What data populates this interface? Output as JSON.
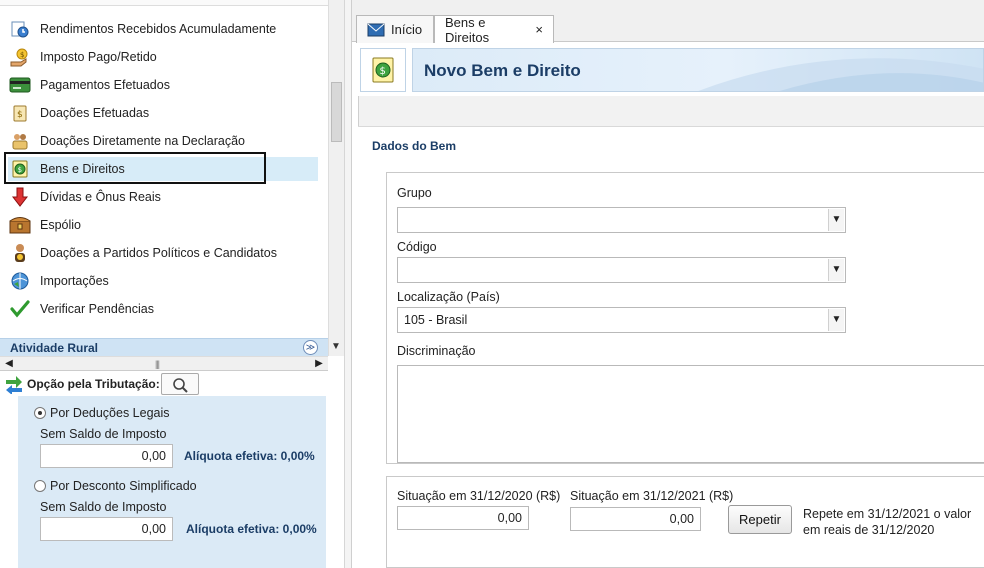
{
  "nav": {
    "items": [
      {
        "label": "Rendimentos Recebidos Acumuladamente",
        "icon": "cash-clock-icon"
      },
      {
        "label": "Imposto Pago/Retido",
        "icon": "hand-coin-icon"
      },
      {
        "label": "Pagamentos Efetuados",
        "icon": "card-icon"
      },
      {
        "label": "Doações Efetuadas",
        "icon": "money-bag-icon"
      },
      {
        "label": "Doações Diretamente na Declaração",
        "icon": "people-coin-icon"
      },
      {
        "label": "Bens e Direitos",
        "icon": "money-document-icon"
      },
      {
        "label": "Dívidas e Ônus Reais",
        "icon": "red-down-arrow-icon"
      },
      {
        "label": "Espólio",
        "icon": "chest-icon"
      },
      {
        "label": "Doações a Partidos Políticos e Candidatos",
        "icon": "person-coin-icon"
      },
      {
        "label": "Importações",
        "icon": "import-globe-icon"
      },
      {
        "label": "Verificar Pendências",
        "icon": "checkmark-icon"
      }
    ],
    "section": "Atividade Rural"
  },
  "tributacao": {
    "label": "Opção pela Tributação:",
    "deducoes": {
      "label": "Por Deduções Legais",
      "sub": "Sem Saldo de Imposto",
      "value": "0,00",
      "aliquota": "Alíquota efetiva: 0,00%",
      "selected": true
    },
    "simplificado": {
      "label": "Por Desconto Simplificado",
      "sub": "Sem Saldo de Imposto",
      "value": "0,00",
      "aliquota": "Alíquota efetiva: 0,00%",
      "selected": false
    }
  },
  "tabs": {
    "inicio": "Início",
    "bens": "Bens e Direitos",
    "close": "×"
  },
  "header": {
    "title": "Novo Bem e Direito"
  },
  "form": {
    "section": "Dados do Bem",
    "grupo_label": "Grupo",
    "grupo_value": "",
    "codigo_label": "Código",
    "codigo_value": "",
    "localizacao_label": "Localização (País)",
    "localizacao_value": "105 - Brasil",
    "discriminacao_label": "Discriminação",
    "discriminacao_value": "",
    "sit2020_label": "Situação em 31/12/2020 (R$)",
    "sit2020_value": "0,00",
    "sit2021_label": "Situação em 31/12/2021 (R$)",
    "sit2021_value": "0,00",
    "repetir_label": "Repetir",
    "repete_text": "Repete em 31/12/2021 o valor em reais de 31/12/2020"
  },
  "colors": {
    "accent": "#1b3d66",
    "selection": "#d7ecf8",
    "panel": "#dbeaf6"
  }
}
